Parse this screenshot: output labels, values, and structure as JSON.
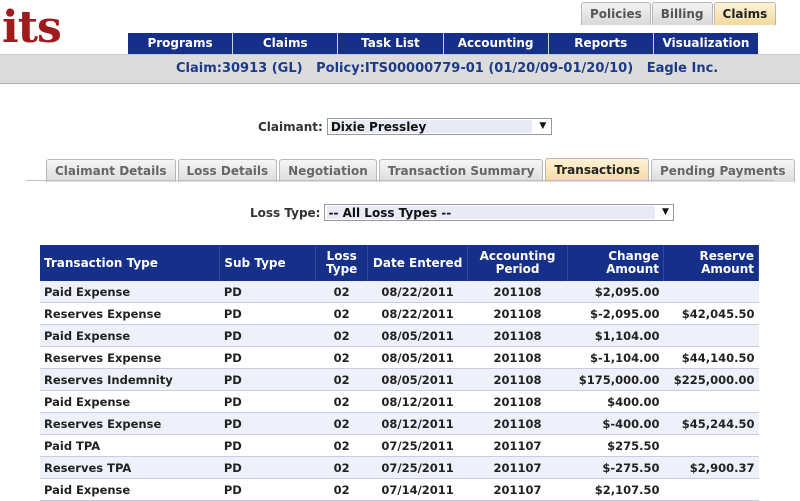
{
  "logo": "its",
  "top_tabs": [
    {
      "label": "Policies",
      "active": false
    },
    {
      "label": "Billing",
      "active": false
    },
    {
      "label": "Claims",
      "active": true
    }
  ],
  "nav": [
    "Programs",
    "Claims",
    "Task List",
    "Accounting",
    "Reports",
    "Visualization"
  ],
  "claim_bar": "Claim:30913 (GL)   Policy:ITS00000779-01 (01/20/09-01/20/10)   Eagle Inc.",
  "claimant": {
    "label": "Claimant:",
    "value": "Dixie Pressley"
  },
  "sub_tabs": [
    {
      "label": "Claimant Details",
      "active": false
    },
    {
      "label": "Loss Details",
      "active": false
    },
    {
      "label": "Negotiation",
      "active": false
    },
    {
      "label": "Transaction Summary",
      "active": false
    },
    {
      "label": "Transactions",
      "active": true
    },
    {
      "label": "Pending Payments",
      "active": false
    }
  ],
  "loss_type": {
    "label": "Loss Type:",
    "value": "-- All Loss Types --"
  },
  "table": {
    "headers": [
      "Transaction Type",
      "Sub Type",
      "Loss Type",
      "Date Entered",
      "Accounting Period",
      "Change Amount",
      "Reserve Amount"
    ],
    "rows": [
      [
        "Paid Expense",
        "PD",
        "02",
        "08/22/2011",
        "201108",
        "$2,095.00",
        ""
      ],
      [
        "Reserves Expense",
        "PD",
        "02",
        "08/22/2011",
        "201108",
        "$-2,095.00",
        "$42,045.50"
      ],
      [
        "Paid Expense",
        "PD",
        "02",
        "08/05/2011",
        "201108",
        "$1,104.00",
        ""
      ],
      [
        "Reserves Expense",
        "PD",
        "02",
        "08/05/2011",
        "201108",
        "$-1,104.00",
        "$44,140.50"
      ],
      [
        "Reserves Indemnity",
        "PD",
        "02",
        "08/05/2011",
        "201108",
        "$175,000.00",
        "$225,000.00"
      ],
      [
        "Paid Expense",
        "PD",
        "02",
        "08/12/2011",
        "201108",
        "$400.00",
        ""
      ],
      [
        "Reserves Expense",
        "PD",
        "02",
        "08/12/2011",
        "201108",
        "$-400.00",
        "$45,244.50"
      ],
      [
        "Paid TPA",
        "PD",
        "02",
        "07/25/2011",
        "201107",
        "$275.50",
        ""
      ],
      [
        "Reserves TPA",
        "PD",
        "02",
        "07/25/2011",
        "201107",
        "$-275.50",
        "$2,900.37"
      ],
      [
        "Paid Expense",
        "PD",
        "02",
        "07/14/2011",
        "201107",
        "$2,107.50",
        ""
      ]
    ]
  }
}
